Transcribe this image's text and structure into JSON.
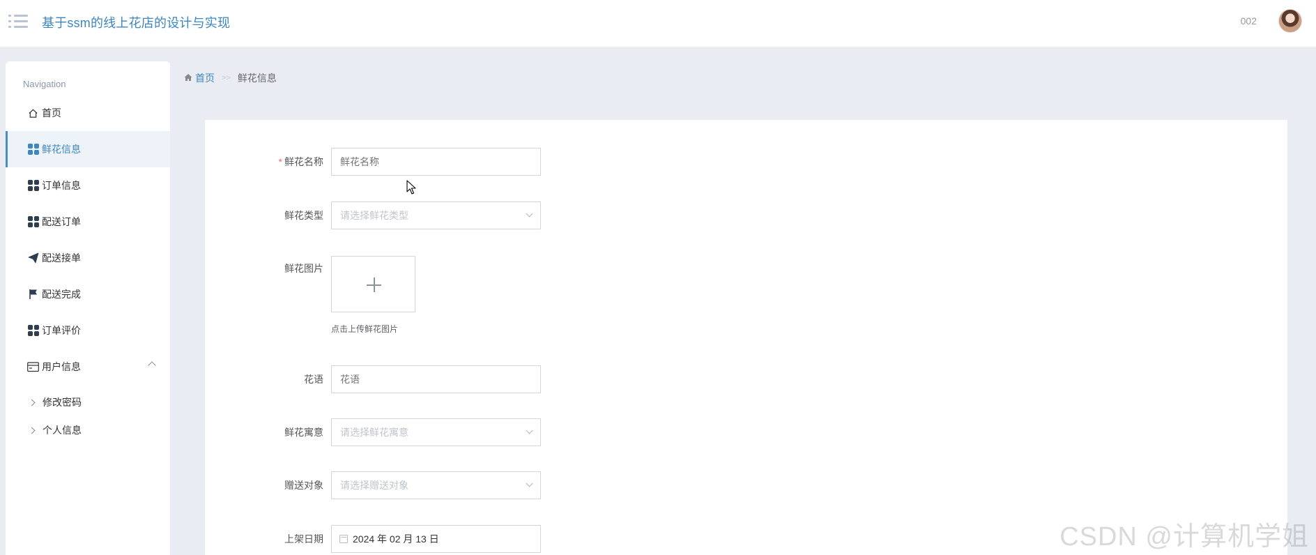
{
  "header": {
    "title": "基于ssm的线上花店的设计与实现",
    "user_name": "002"
  },
  "sidebar": {
    "title": "Navigation",
    "items": [
      {
        "label": "首页",
        "icon": "home-icon"
      },
      {
        "label": "鲜花信息",
        "icon": "grid-icon",
        "active": true
      },
      {
        "label": "订单信息",
        "icon": "grid-icon"
      },
      {
        "label": "配送订单",
        "icon": "grid-icon"
      },
      {
        "label": "配送接单",
        "icon": "paper-plane-icon"
      },
      {
        "label": "配送完成",
        "icon": "flag-icon"
      },
      {
        "label": "订单评价",
        "icon": "grid-icon"
      },
      {
        "label": "用户信息",
        "icon": "card-icon",
        "expanded": true
      }
    ],
    "subitems": [
      {
        "label": "修改密码"
      },
      {
        "label": "个人信息"
      }
    ]
  },
  "breadcrumb": {
    "home": "首页",
    "separator": ">>",
    "current": "鲜花信息"
  },
  "form": {
    "name": {
      "label": "鲜花名称",
      "placeholder": "鲜花名称",
      "required": true
    },
    "type": {
      "label": "鲜花类型",
      "placeholder": "请选择鲜花类型"
    },
    "image": {
      "label": "鲜花图片",
      "hint": "点击上传鲜花图片"
    },
    "language": {
      "label": "花语",
      "placeholder": "花语"
    },
    "meaning": {
      "label": "鲜花寓意",
      "placeholder": "请选择鲜花寓意"
    },
    "target": {
      "label": "赠送对象",
      "placeholder": "请选择赠送对象"
    },
    "date": {
      "label": "上架日期",
      "value": "2024 年 02 月 13 日"
    }
  },
  "watermark": "CSDN @计算机学姐",
  "colors": {
    "accent": "#3d86c0",
    "background": "#e9edf3",
    "required": "#f56c6c"
  }
}
